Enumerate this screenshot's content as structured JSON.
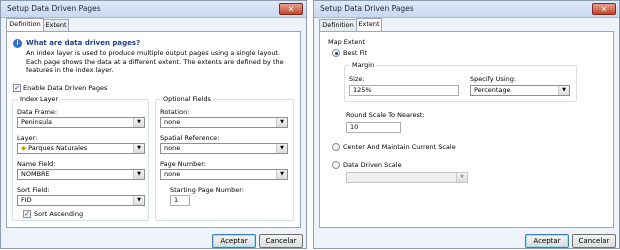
{
  "left_dialog": {
    "title": "Setup Data Driven Pages",
    "close_glyph": "✕",
    "tabs": [
      "Definition",
      "Extent"
    ],
    "heading": "What are data driven pages?",
    "description": "An index layer is used to produce multiple output pages using a single layout.  Each page shows the data at a different extent.  The extents are defined by the features in the index layer.",
    "enable_label": "Enable Data Driven Pages",
    "enable_checked": true,
    "index_layer": {
      "title": "Index Layer",
      "data_frame_label": "Data Frame:",
      "data_frame_value": "Peninsula",
      "layer_label": "Layer:",
      "layer_value": "Parques Naturales",
      "name_field_label": "Name Field:",
      "name_field_value": "NOMBRE",
      "sort_field_label": "Sort Field:",
      "sort_field_value": "FID",
      "sort_ascending_label": "Sort Ascending",
      "sort_ascending_checked": true
    },
    "optional_fields": {
      "title": "Optional Fields",
      "rotation_label": "Rotation:",
      "rotation_value": "none",
      "spatial_ref_label": "Spatial Reference:",
      "spatial_ref_value": "none",
      "page_number_label": "Page Number:",
      "page_number_value": "none",
      "starting_page_label": "Starting Page Number:",
      "starting_page_value": "1"
    },
    "ok_label": "Aceptar",
    "cancel_label": "Cancelar"
  },
  "right_dialog": {
    "title": "Setup Data Driven Pages",
    "close_glyph": "✕",
    "tabs": [
      "Definition",
      "Extent"
    ],
    "map_extent_title": "Map Extent",
    "best_fit_label": "Best Fit",
    "margin_title": "Margin",
    "size_label": "Size:",
    "size_value": "125%",
    "specify_using_label": "Specify Using:",
    "specify_using_value": "Percentage",
    "round_scale_label": "Round Scale To Nearest:",
    "round_scale_value": "10",
    "center_label": "Center And Maintain Current Scale",
    "data_driven_label": "Data Driven Scale",
    "data_driven_value": "",
    "ok_label": "Aceptar",
    "cancel_label": "Cancelar",
    "selected_option": "best_fit"
  },
  "arrow_glyph": "▼"
}
